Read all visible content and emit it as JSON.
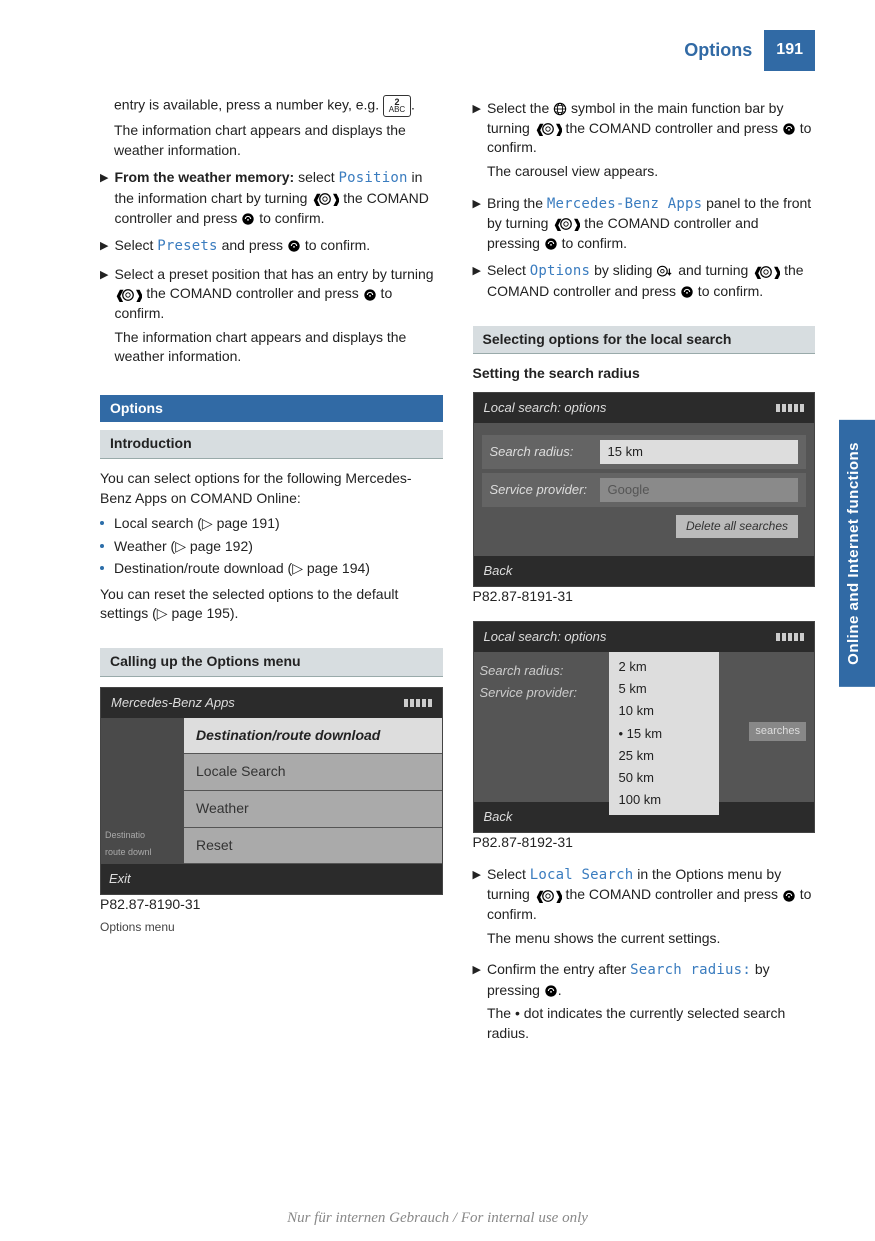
{
  "header": {
    "title": "Options",
    "page": "191"
  },
  "side_tab": "Online and Internet functions",
  "footer": "Nur für internen Gebrauch / For internal use only",
  "left": {
    "intro1a": "entry is available, press a number key, e.g.",
    "intro1b": ".",
    "intro2": "The information chart appears and displays the weather information.",
    "step_mem_pre": "From the weather memory:",
    "step_mem_mid": " select ",
    "step_mem_ui": "Position",
    "step_mem_post": " in the information chart by turning ",
    "step_mem_tail": " the COMAND controller and press ",
    "step_mem_end": " to confirm.",
    "step_presets_a": "Select ",
    "step_presets_ui": "Presets",
    "step_presets_b": " and press ",
    "step_presets_c": " to confirm.",
    "step_preset_pos": "Select a preset position that has an entry by turning ",
    "step_preset_pos_mid": " the COMAND controller and press ",
    "step_preset_pos_end": " to confirm.",
    "step_preset_pos_res": "The information chart appears and displays the weather information.",
    "sec_options": "Options",
    "sec_intro": "Introduction",
    "intro_para": "You can select options for the following Mercedes-Benz Apps on COMAND Online:",
    "bullets": [
      "Local search (▷ page 191)",
      "Weather (▷ page 192)",
      "Destination/route download (▷ page 194)"
    ],
    "reset_para": "You can reset the selected options to the default settings (▷ page 195).",
    "sec_calling": "Calling up the Options menu",
    "shot1": {
      "title": "Mercedes-Benz Apps",
      "side": [
        "",
        "Destinatio",
        "route downl"
      ],
      "items": [
        "Destination/route download",
        "Locale Search",
        "Weather",
        "Reset"
      ],
      "exit": "Exit",
      "stamp": "P82.87-8190-31",
      "caption": "Options menu"
    }
  },
  "right": {
    "step_globe_a": "Select the ",
    "step_globe_b": " symbol in the main function bar by turning ",
    "step_globe_c": " the COMAND controller and press ",
    "step_globe_d": " to confirm.",
    "step_globe_res": "The carousel view appears.",
    "step_mb_a": "Bring the ",
    "step_mb_ui": "Mercedes-Benz Apps",
    "step_mb_b": " panel to the front by turning ",
    "step_mb_c": " the COMAND controller and pressing ",
    "step_mb_d": " to confirm.",
    "step_opt_a": "Select ",
    "step_opt_ui": "Options",
    "step_opt_b": " by sliding ",
    "step_opt_c": " and turning ",
    "step_opt_d": " the COMAND controller and press ",
    "step_opt_e": " to confirm.",
    "sec_local": "Selecting options for the local search",
    "hd_radius": "Setting the search radius",
    "shot2": {
      "title": "Local search: options",
      "row1_label": "Search radius:",
      "row1_value": "15 km",
      "row2_label": "Service provider:",
      "row2_value": "Google",
      "delete": "Delete all searches",
      "back": "Back",
      "stamp": "P82.87-8191-31"
    },
    "shot3": {
      "title": "Local search: options",
      "row1_label": "Search radius:",
      "row2_label": "Service provider:",
      "options": [
        "2 km",
        "5 km",
        "10 km",
        "15 km",
        "25 km",
        "50 km",
        "100 km"
      ],
      "selected": "15 km",
      "sidebtn": "searches",
      "back": "Back",
      "stamp": "P82.87-8192-31"
    },
    "step_ls_a": "Select ",
    "step_ls_ui": "Local Search",
    "step_ls_b": " in the Options menu by turning ",
    "step_ls_c": " the COMAND controller and press ",
    "step_ls_d": " to confirm.",
    "step_ls_res": "The menu shows the current settings.",
    "step_conf_a": "Confirm the entry after ",
    "step_conf_ui": "Search radius:",
    "step_conf_b": " by pressing ",
    "step_conf_c": ".",
    "step_conf_res": "The • dot indicates the currently selected search radius."
  }
}
